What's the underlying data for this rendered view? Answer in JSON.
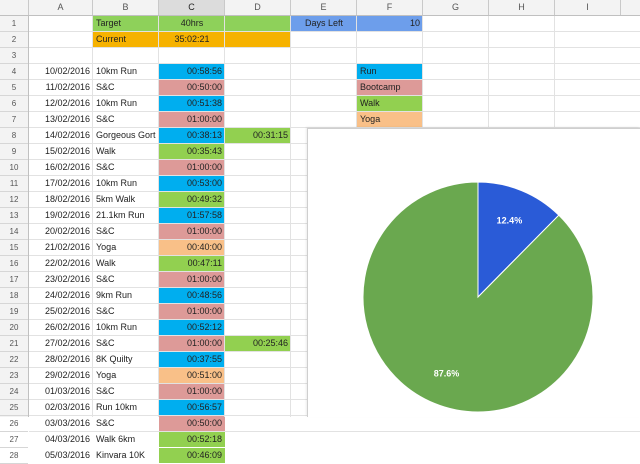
{
  "columns": [
    "A",
    "B",
    "C",
    "D",
    "E",
    "F",
    "G",
    "H",
    "I"
  ],
  "row_numbers": [
    "1",
    "2",
    "3",
    "4",
    "5",
    "6",
    "7",
    "8",
    "9",
    "10",
    "11",
    "12",
    "13",
    "14",
    "15",
    "16",
    "17",
    "18",
    "19",
    "20",
    "21",
    "22",
    "23",
    "24",
    "25",
    "26",
    "27",
    "28"
  ],
  "summary": {
    "target_label": "Target",
    "target_value": "40hrs",
    "current_label": "Current",
    "current_value": "35:02:21",
    "days_left_label": "Days Left",
    "days_left_value": "10"
  },
  "legend": [
    {
      "label": "Run",
      "color": "#00aeef"
    },
    {
      "label": "Bootcamp",
      "color": "#dd9a98"
    },
    {
      "label": "Walk",
      "color": "#92d050"
    },
    {
      "label": "Yoga",
      "color": "#f9c088"
    }
  ],
  "colors": {
    "target_green": "#8ed15a",
    "current_orange": "#f6b200",
    "days_blue": "#6d9eeb",
    "run": "#00aeef",
    "bootcamp": "#dd9a98",
    "walk": "#92d050",
    "yoga": "#f9c088",
    "pie_blue": "#2a5bd7",
    "pie_green": "#6aa84f"
  },
  "rows": [
    {
      "date": "10/02/2016",
      "activity": "10km Run",
      "time": "00:58:56",
      "cat": "run",
      "extra": ""
    },
    {
      "date": "11/02/2016",
      "activity": "S&C",
      "time": "00:50:00",
      "cat": "bootcamp",
      "extra": ""
    },
    {
      "date": "12/02/2016",
      "activity": "10km Run",
      "time": "00:51:38",
      "cat": "run",
      "extra": ""
    },
    {
      "date": "13/02/2016",
      "activity": "S&C",
      "time": "01:00:00",
      "cat": "bootcamp",
      "extra": ""
    },
    {
      "date": "14/02/2016",
      "activity": "Gorgeous Gort",
      "time": "00:38:13",
      "cat": "run",
      "extra": "00:31:15"
    },
    {
      "date": "15/02/2016",
      "activity": "Walk",
      "time": "00:35:43",
      "cat": "walk",
      "extra": ""
    },
    {
      "date": "16/02/2016",
      "activity": "S&C",
      "time": "01:00:00",
      "cat": "bootcamp",
      "extra": ""
    },
    {
      "date": "17/02/2016",
      "activity": "10km Run",
      "time": "00:53:00",
      "cat": "run",
      "extra": ""
    },
    {
      "date": "18/02/2016",
      "activity": "5km Walk",
      "time": "00:49:32",
      "cat": "walk",
      "extra": ""
    },
    {
      "date": "19/02/2016",
      "activity": "21.1km Run",
      "time": "01:57:58",
      "cat": "run",
      "extra": ""
    },
    {
      "date": "20/02/2016",
      "activity": "S&C",
      "time": "01:00:00",
      "cat": "bootcamp",
      "extra": ""
    },
    {
      "date": "21/02/2016",
      "activity": "Yoga",
      "time": "00:40:00",
      "cat": "yoga",
      "extra": ""
    },
    {
      "date": "22/02/2016",
      "activity": "Walk",
      "time": "00:47:11",
      "cat": "walk",
      "extra": ""
    },
    {
      "date": "23/02/2016",
      "activity": "S&C",
      "time": "01:00:00",
      "cat": "bootcamp",
      "extra": ""
    },
    {
      "date": "24/02/2016",
      "activity": "9km Run",
      "time": "00:48:56",
      "cat": "run",
      "extra": ""
    },
    {
      "date": "25/02/2016",
      "activity": "S&C",
      "time": "01:00:00",
      "cat": "bootcamp",
      "extra": ""
    },
    {
      "date": "26/02/2016",
      "activity": "10km Run",
      "time": "00:52:12",
      "cat": "run",
      "extra": ""
    },
    {
      "date": "27/02/2016",
      "activity": "S&C",
      "time": "01:00:00",
      "cat": "bootcamp",
      "extra": "00:25:46"
    },
    {
      "date": "28/02/2016",
      "activity": "8K Quilty",
      "time": "00:37:55",
      "cat": "run",
      "extra": ""
    },
    {
      "date": "29/02/2016",
      "activity": "Yoga",
      "time": "00:51:00",
      "cat": "yoga",
      "extra": ""
    },
    {
      "date": "01/03/2016",
      "activity": "S&C",
      "time": "01:00:00",
      "cat": "bootcamp",
      "extra": ""
    },
    {
      "date": "02/03/2016",
      "activity": "Run 10km",
      "time": "00:56:57",
      "cat": "run",
      "extra": ""
    },
    {
      "date": "03/03/2016",
      "activity": "S&C",
      "time": "00:50:00",
      "cat": "bootcamp",
      "extra": ""
    },
    {
      "date": "04/03/2016",
      "activity": "Walk 6km",
      "time": "00:52:18",
      "cat": "walk",
      "extra": ""
    },
    {
      "date": "05/03/2016",
      "activity": "Kinvara 10K",
      "time": "00:46:09",
      "cat": "walk",
      "extra": ""
    }
  ],
  "chart_data": {
    "type": "pie",
    "slices": [
      {
        "label": "12.4%",
        "value": 12.4,
        "color": "#2a5bd7"
      },
      {
        "label": "87.6%",
        "value": 87.6,
        "color": "#6aa84f"
      }
    ]
  }
}
